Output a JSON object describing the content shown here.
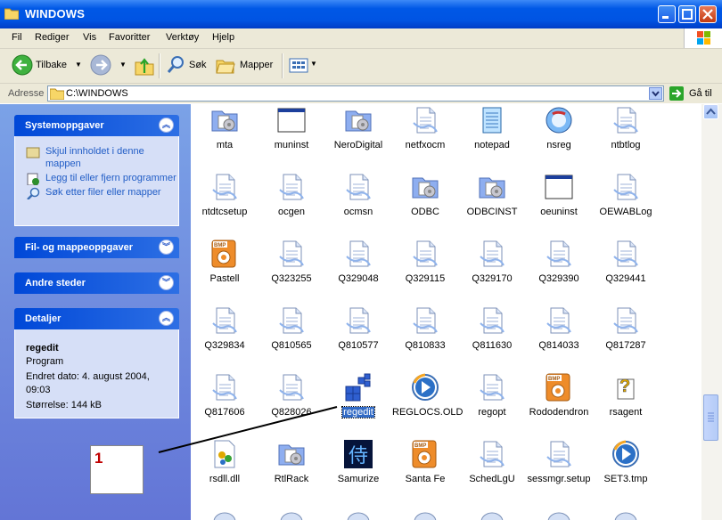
{
  "window": {
    "title": "WINDOWS"
  },
  "menu": [
    "Fil",
    "Rediger",
    "Vis",
    "Favoritter",
    "Verktøy",
    "Hjelp"
  ],
  "toolbar": {
    "back": "Tilbake",
    "search": "Søk",
    "folders": "Mapper"
  },
  "address": {
    "label": "Adresse",
    "path": "C:\\WINDOWS",
    "go": "Gå til"
  },
  "panels": {
    "system": {
      "title": "Systemoppgaver",
      "tasks": [
        "Skjul innholdet i denne mappen",
        "Legg til eller fjern programmer",
        "Søk etter filer eller mapper"
      ]
    },
    "file": {
      "title": "Fil- og mappeoppgaver"
    },
    "other": {
      "title": "Andre steder"
    },
    "details": {
      "title": "Detaljer",
      "name": "regedit",
      "type": "Program",
      "modified": "Endret dato: 4. august 2004, 09:03",
      "size": "Størrelse: 144 kB"
    }
  },
  "files": [
    {
      "name": "mta",
      "icon": "folder-icon"
    },
    {
      "name": "muninst",
      "icon": "window-app-icon"
    },
    {
      "name": "NeroDigital",
      "icon": "folder-icon"
    },
    {
      "name": "netfxocm",
      "icon": "document-icon"
    },
    {
      "name": "notepad",
      "icon": "notepad-icon"
    },
    {
      "name": "nsreg",
      "icon": "nsreg-icon"
    },
    {
      "name": "ntbtlog",
      "icon": "document-icon"
    },
    {
      "name": "ntdtcsetup",
      "icon": "document-icon"
    },
    {
      "name": "ocgen",
      "icon": "document-icon"
    },
    {
      "name": "ocmsn",
      "icon": "document-icon"
    },
    {
      "name": "ODBC",
      "icon": "folder-icon"
    },
    {
      "name": "ODBCINST",
      "icon": "folder-icon"
    },
    {
      "name": "oeuninst",
      "icon": "window-app-icon"
    },
    {
      "name": "OEWABLog",
      "icon": "document-icon"
    },
    {
      "name": "Pastell",
      "icon": "bmp-icon"
    },
    {
      "name": "Q323255",
      "icon": "document-icon"
    },
    {
      "name": "Q329048",
      "icon": "document-icon"
    },
    {
      "name": "Q329115",
      "icon": "document-icon"
    },
    {
      "name": "Q329170",
      "icon": "document-icon"
    },
    {
      "name": "Q329390",
      "icon": "document-icon"
    },
    {
      "name": "Q329441",
      "icon": "document-icon"
    },
    {
      "name": "Q329834",
      "icon": "document-icon"
    },
    {
      "name": "Q810565",
      "icon": "document-icon"
    },
    {
      "name": "Q810577",
      "icon": "document-icon"
    },
    {
      "name": "Q810833",
      "icon": "document-icon"
    },
    {
      "name": "Q811630",
      "icon": "document-icon"
    },
    {
      "name": "Q814033",
      "icon": "document-icon"
    },
    {
      "name": "Q817287",
      "icon": "document-icon"
    },
    {
      "name": "Q817606",
      "icon": "document-icon"
    },
    {
      "name": "Q828026",
      "icon": "document-icon"
    },
    {
      "name": "regedit",
      "icon": "regedit-icon",
      "selected": true
    },
    {
      "name": "REGLOCS.OLD",
      "icon": "media-icon"
    },
    {
      "name": "regopt",
      "icon": "document-icon"
    },
    {
      "name": "Rododendron",
      "icon": "bmp-icon"
    },
    {
      "name": "rsagent",
      "icon": "help-icon"
    },
    {
      "name": "rsdll.dll",
      "icon": "dll-icon"
    },
    {
      "name": "RtlRack",
      "icon": "folder-icon"
    },
    {
      "name": "Samurize",
      "icon": "samurize-icon"
    },
    {
      "name": "Santa Fe",
      "icon": "bmp-icon"
    },
    {
      "name": "SchedLgU",
      "icon": "document-icon"
    },
    {
      "name": "sessmgr.setup",
      "icon": "document-icon"
    },
    {
      "name": "SET3.tmp",
      "icon": "media-icon"
    }
  ],
  "annotation": {
    "number": "1"
  },
  "colors": {
    "titlebar": "#0054e3",
    "taskpane": "#6375d6",
    "selection": "#316ac5"
  }
}
